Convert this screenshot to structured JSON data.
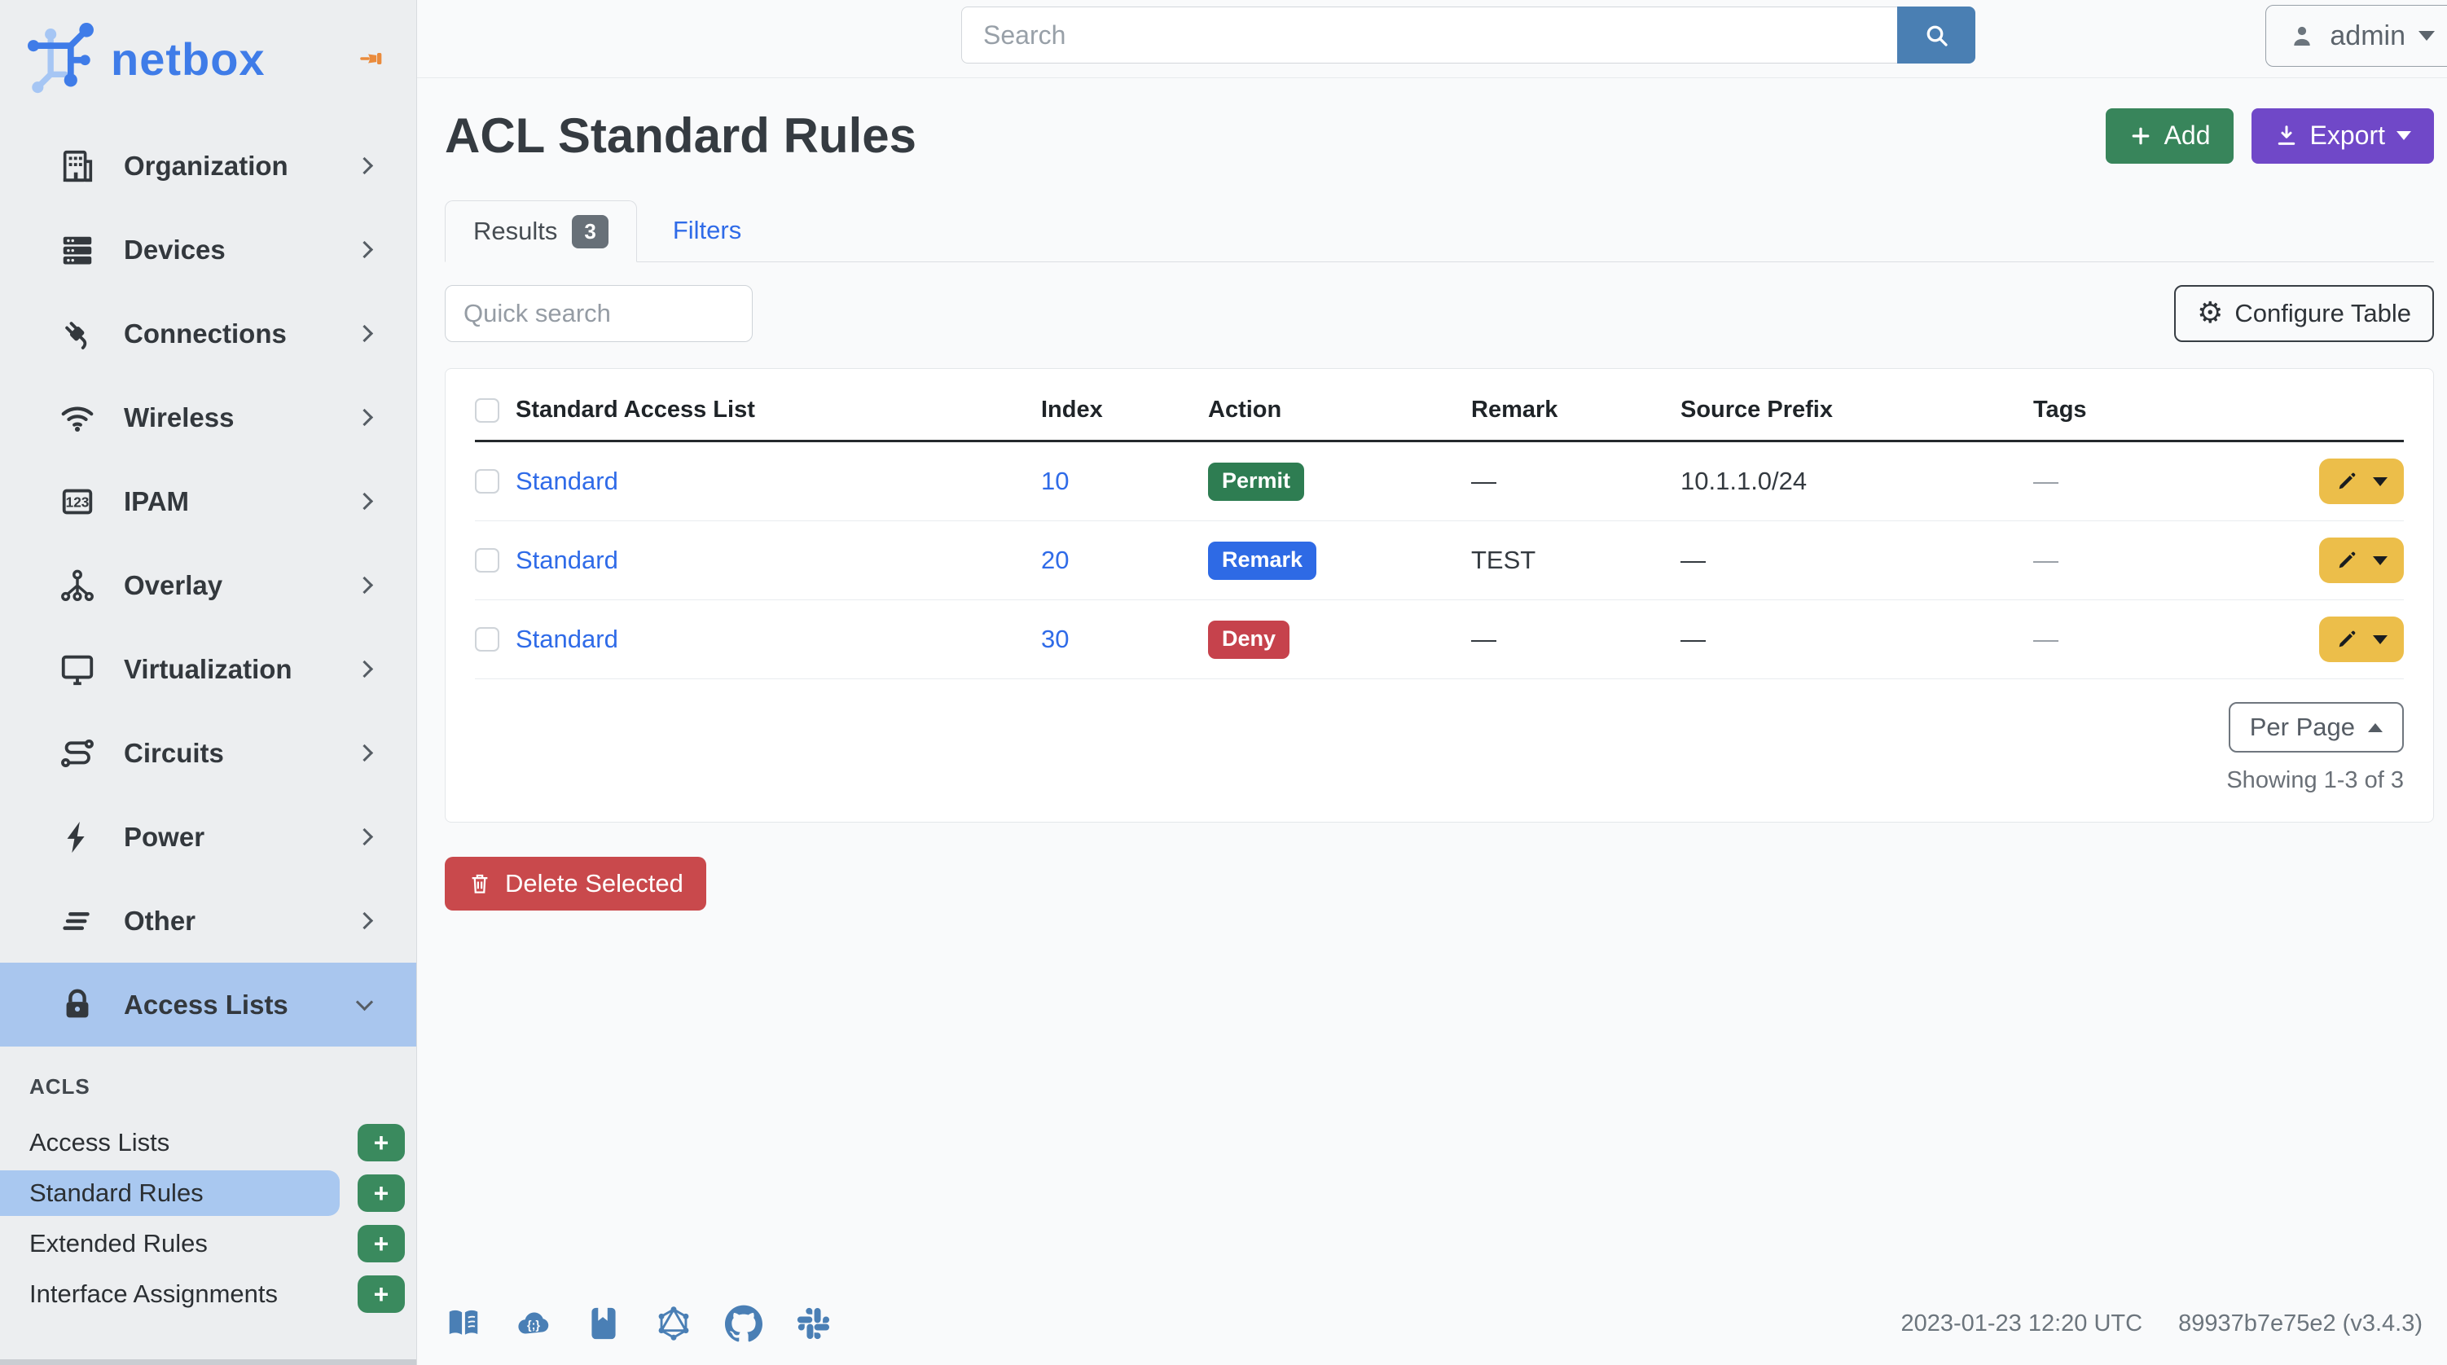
{
  "brand": {
    "name": "netbox"
  },
  "sidebar": {
    "items": [
      {
        "label": "Organization"
      },
      {
        "label": "Devices"
      },
      {
        "label": "Connections"
      },
      {
        "label": "Wireless"
      },
      {
        "label": "IPAM"
      },
      {
        "label": "Overlay"
      },
      {
        "label": "Virtualization"
      },
      {
        "label": "Circuits"
      },
      {
        "label": "Power"
      },
      {
        "label": "Other"
      },
      {
        "label": "Access Lists",
        "state": "active-expanded"
      }
    ],
    "section": {
      "title": "ACLS",
      "add_label": "+",
      "items": [
        {
          "label": "Access Lists"
        },
        {
          "label": "Standard Rules",
          "active": true
        },
        {
          "label": "Extended Rules"
        },
        {
          "label": "Interface Assignments"
        }
      ]
    }
  },
  "topbar": {
    "search_placeholder": "Search",
    "user": "admin"
  },
  "page": {
    "title": "ACL Standard Rules",
    "add_label": "Add",
    "export_label": "Export"
  },
  "tabs": {
    "results": "Results",
    "results_count": "3",
    "filters": "Filters"
  },
  "table_controls": {
    "quick_search_placeholder": "Quick search",
    "configure_label": "Configure Table",
    "gear_glyph": "⚙"
  },
  "table": {
    "columns": [
      "Standard Access List",
      "Index",
      "Action",
      "Remark",
      "Source Prefix",
      "Tags"
    ],
    "rows": [
      {
        "name": "Standard",
        "index": "10",
        "action": "Permit",
        "remark": "—",
        "source_prefix": "10.1.1.0/24",
        "tags": "—"
      },
      {
        "name": "Standard",
        "index": "20",
        "action": "Remark",
        "remark": "TEST",
        "source_prefix": "—",
        "tags": "—"
      },
      {
        "name": "Standard",
        "index": "30",
        "action": "Deny",
        "remark": "—",
        "source_prefix": "—",
        "tags": "—"
      }
    ]
  },
  "pagination": {
    "per_page_label": "Per Page",
    "showing": "Showing 1-3 of 3"
  },
  "bulk_actions": {
    "delete_label": "Delete Selected"
  },
  "footer": {
    "timestamp": "2023-01-23 12:20 UTC",
    "version": "89937b7e75e2 (v3.4.3)",
    "icons": [
      "docs-book-icon",
      "api-cloud-icon",
      "source-journal-icon",
      "graphql-icon",
      "github-icon",
      "slack-icon"
    ]
  },
  "colors": {
    "brand_blue": "#3f7ce8",
    "sidebar_active": "#a9c6ee",
    "link_blue": "#2f6be8",
    "permit_green": "#2e7d52",
    "remark_blue": "#2e6ae5",
    "deny_red": "#c6424c",
    "add_green": "#38855b",
    "export_purple": "#7048c8",
    "delete_red": "#c9494c",
    "edit_yellow": "#ecbe4a",
    "search_blue": "#4a7fb3",
    "footer_icon_blue": "#4a7fb5",
    "pin_orange": "#ea8b3c"
  }
}
